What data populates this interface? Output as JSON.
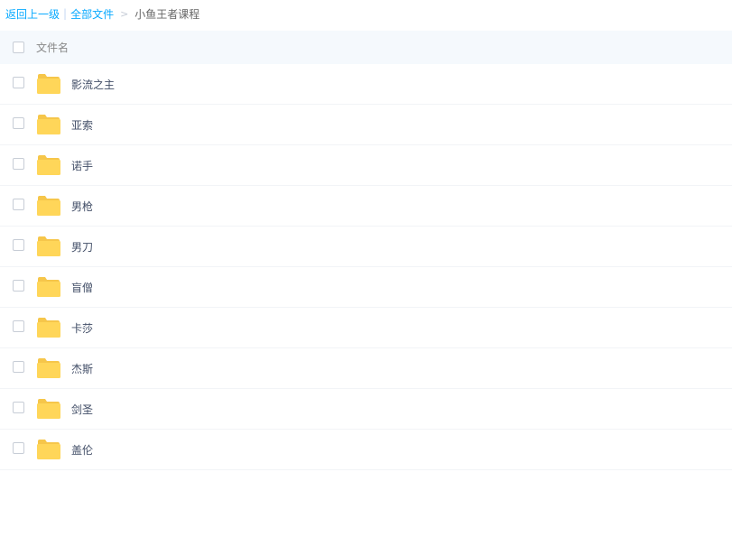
{
  "breadcrumb": {
    "back": "返回上一级",
    "separator": "|",
    "all_files": "全部文件",
    "arrow": ">",
    "current": "小鱼王者课程"
  },
  "header": {
    "column_name": "文件名"
  },
  "files": [
    {
      "name": "影流之主",
      "icon": "folder-icon"
    },
    {
      "name": "亚索",
      "icon": "folder-icon"
    },
    {
      "name": "诺手",
      "icon": "folder-icon"
    },
    {
      "name": "男枪",
      "icon": "folder-icon"
    },
    {
      "name": "男刀",
      "icon": "folder-icon"
    },
    {
      "name": "盲僧",
      "icon": "folder-icon"
    },
    {
      "name": "卡莎",
      "icon": "folder-icon"
    },
    {
      "name": "杰斯",
      "icon": "folder-icon"
    },
    {
      "name": "剑圣",
      "icon": "folder-icon"
    },
    {
      "name": "盖伦",
      "icon": "folder-icon"
    }
  ],
  "colors": {
    "link": "#09aaff",
    "folder": "#ffd659",
    "folder_tab": "#f6c64a",
    "header_bg": "#f5f9fd"
  }
}
